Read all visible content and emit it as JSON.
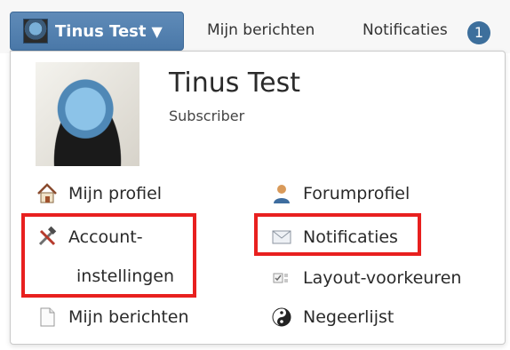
{
  "topbar": {
    "user_button_label": "Tinus Test",
    "caret": "▼",
    "links": {
      "berichten": "Mijn berichten",
      "notificaties": "Notificaties"
    },
    "notification_count": "1"
  },
  "profile": {
    "name": "Tinus Test",
    "role": "Subscriber"
  },
  "menu": {
    "left": {
      "profiel": "Mijn profiel",
      "account_line1": "Account-",
      "account_line2": "instellingen",
      "berichten": "Mijn berichten"
    },
    "right": {
      "forumprofiel": "Forumprofiel",
      "notificaties": "Notificaties",
      "layout": "Layout-voorkeuren",
      "negeerlijst": "Negeerlijst"
    }
  },
  "icons": {
    "home": "home-icon",
    "tools": "tools-icon",
    "document": "document-icon",
    "user": "user-icon",
    "mail": "mail-icon",
    "layout": "layout-icon",
    "yin_yang": "yin-yang-icon"
  },
  "colors": {
    "accent": "#4a78a8",
    "badge": "#3d6f9c",
    "highlight": "#e8201f"
  }
}
